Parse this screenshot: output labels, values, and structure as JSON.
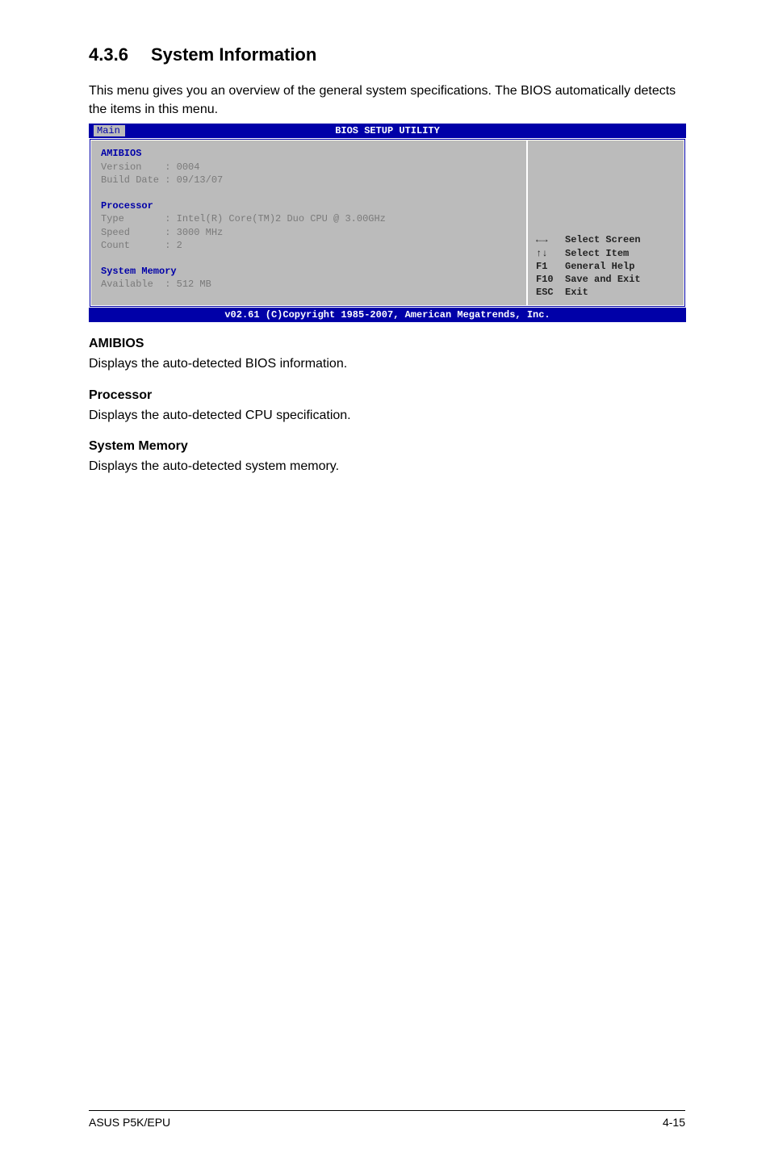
{
  "heading": {
    "number": "4.3.6",
    "title": "System Information"
  },
  "intro": "This menu gives you an overview of the general system specifications. The BIOS automatically detects the items in this menu.",
  "bios": {
    "title": "BIOS SETUP UTILITY",
    "tab": "Main",
    "amibios": {
      "label": "AMIBIOS",
      "version_label": "Version",
      "version_value": "0004",
      "build_label": "Build Date",
      "build_value": "09/13/07"
    },
    "processor": {
      "label": "Processor",
      "type_label": "Type",
      "type_value": "Intel(R) Core(TM)2 Duo CPU @ 3.00GHz",
      "speed_label": "Speed",
      "speed_value": "3000 MHz",
      "count_label": "Count",
      "count_value": "2"
    },
    "memory": {
      "label": "System Memory",
      "available_label": "Available",
      "available_value": "512 MB"
    },
    "help": {
      "select_screen": "Select Screen",
      "select_item": "Select Item",
      "f1_key": "F1",
      "f1_text": "General Help",
      "f10_key": "F10",
      "f10_text": "Save and Exit",
      "esc_key": "ESC",
      "esc_text": "Exit"
    },
    "footer": "v02.61 (C)Copyright 1985-2007, American Megatrends, Inc."
  },
  "sections": {
    "amibios": {
      "title": "AMIBIOS",
      "text": "Displays the auto-detected BIOS information."
    },
    "processor": {
      "title": "Processor",
      "text": "Displays the auto-detected CPU specification."
    },
    "memory": {
      "title": "System Memory",
      "text": "Displays the auto-detected system memory."
    }
  },
  "footer": {
    "left": "ASUS P5K/EPU",
    "right": "4-15"
  }
}
